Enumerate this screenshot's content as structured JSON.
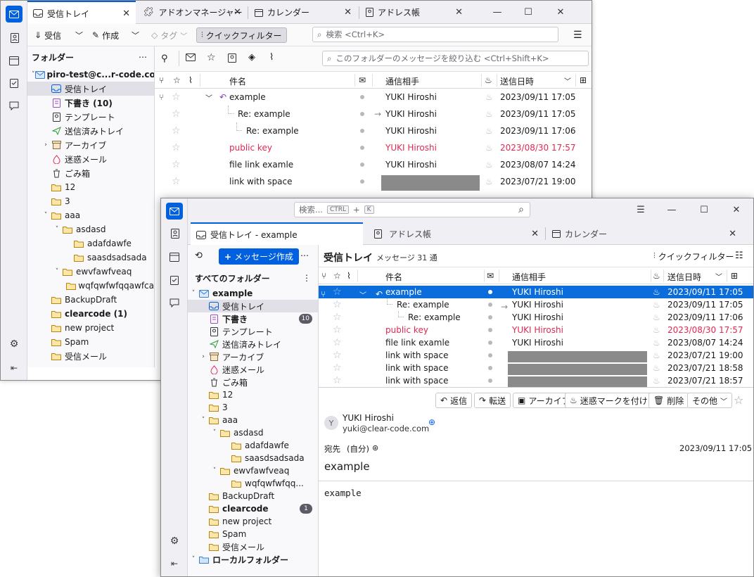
{
  "win1": {
    "tabs": [
      {
        "label": "受信トレイ"
      },
      {
        "label": "アドオンマネージャー"
      },
      {
        "label": "カレンダー"
      },
      {
        "label": "アドレス帳"
      }
    ],
    "toolbar": {
      "get_messages": "受信",
      "compose": "作成",
      "tag": "タグ",
      "quick_filter": "クイックフィルター",
      "search_placeholder": "検索 <Ctrl+K>"
    },
    "folder_pane": {
      "header": "フォルダー",
      "account": "piro-test@c...r-code.com",
      "items": [
        {
          "label": "受信トレイ"
        },
        {
          "label": "下書き (10)"
        },
        {
          "label": "テンプレート"
        },
        {
          "label": "送信済みトレイ"
        },
        {
          "label": "アーカイブ"
        },
        {
          "label": "迷惑メール"
        },
        {
          "label": "ごみ箱"
        },
        {
          "label": "12"
        },
        {
          "label": "3"
        },
        {
          "label": "aaa"
        },
        {
          "label": "asdasd"
        },
        {
          "label": "adafdawfe"
        },
        {
          "label": "saasdsadsada"
        },
        {
          "label": "ewvfawfveaq"
        },
        {
          "label": "wqfqwfwfqqawfca"
        },
        {
          "label": "BackupDraft"
        },
        {
          "label": "clearcode (1)"
        },
        {
          "label": "new project"
        },
        {
          "label": "Spam"
        },
        {
          "label": "受信メール"
        }
      ]
    },
    "filter_placeholder": "このフォルダーのメッセージを絞り込む <Ctrl+Shift+K>",
    "columns": {
      "subject": "件名",
      "correspondent": "通信相手",
      "date": "送信日時"
    },
    "messages": [
      {
        "subject": "example",
        "from": "YUKI Hiroshi",
        "date": "2023/09/11 17:05"
      },
      {
        "subject": "Re: example",
        "from": "YUKI Hiroshi",
        "date": "2023/09/11 17:05"
      },
      {
        "subject": "Re: example",
        "from": "YUKI Hiroshi",
        "date": "2023/09/11 17:06"
      },
      {
        "subject": "public key",
        "from": "YUKI Hiroshi",
        "date": "2023/08/30 17:57"
      },
      {
        "subject": "file link examle",
        "from": "YUKI Hiroshi",
        "date": "2023/08/07 14:24"
      },
      {
        "subject": "link with space",
        "from": "",
        "date": "2023/07/21 19:00"
      }
    ]
  },
  "win2": {
    "search_placeholder": "検索...",
    "search_key1": "CTRL",
    "search_plus": "+",
    "search_key2": "K",
    "tabs": [
      {
        "label": "受信トレイ - example"
      },
      {
        "label": "アドレス帳"
      },
      {
        "label": "カレンダー"
      }
    ],
    "new_message": "メッセージ作成",
    "folder_header": "すべてのフォルダー",
    "folder_title": "受信トレイ",
    "message_count": "メッセージ 31 通",
    "quick_filter": "クイックフィルター",
    "account": "example",
    "folders": [
      {
        "label": "受信トレイ"
      },
      {
        "label": "下書き",
        "badge": "10"
      },
      {
        "label": "テンプレート"
      },
      {
        "label": "送信済みトレイ"
      },
      {
        "label": "アーカイブ"
      },
      {
        "label": "迷惑メール"
      },
      {
        "label": "ごみ箱"
      },
      {
        "label": "12"
      },
      {
        "label": "3"
      },
      {
        "label": "aaa"
      },
      {
        "label": "asdasd"
      },
      {
        "label": "adafdawfe"
      },
      {
        "label": "saasdsadsada"
      },
      {
        "label": "ewvfawfveaq"
      },
      {
        "label": "wqfqwfwfqq..."
      },
      {
        "label": "BackupDraft"
      },
      {
        "label": "clearcode",
        "badge": "1"
      },
      {
        "label": "new project"
      },
      {
        "label": "Spam"
      },
      {
        "label": "受信メール"
      },
      {
        "label": "ローカルフォルダー"
      }
    ],
    "columns": {
      "subject": "件名",
      "correspondent": "通信相手",
      "date": "送信日時"
    },
    "messages": [
      {
        "subject": "example",
        "from": "YUKI Hiroshi",
        "date": "2023/09/11 17:05"
      },
      {
        "subject": "Re: example",
        "from": "YUKI Hiroshi",
        "date": "2023/09/11 17:05"
      },
      {
        "subject": "Re: example",
        "from": "YUKI Hiroshi",
        "date": "2023/09/11 17:06"
      },
      {
        "subject": "public key",
        "from": "YUKI Hiroshi",
        "date": "2023/08/30 17:57"
      },
      {
        "subject": "file link examle",
        "from": "YUKI Hiroshi",
        "date": "2023/08/07 14:24"
      },
      {
        "subject": "link with space",
        "from": "",
        "date": "2023/07/21 19:00"
      },
      {
        "subject": "link with space",
        "from": "",
        "date": "2023/07/21 18:58"
      },
      {
        "subject": "link with space",
        "from": "",
        "date": "2023/07/21 18:57"
      }
    ],
    "reader": {
      "buttons": {
        "reply": "返信",
        "forward": "転送",
        "archive": "アーカイブ",
        "junk": "迷惑マークを付ける",
        "delete": "削除",
        "more": "その他"
      },
      "avatar_letter": "Y",
      "from_name": "YUKI Hiroshi",
      "from_email": "yuki@clear-code.com",
      "to_label": "宛先",
      "to_value": "(自分)",
      "date": "2023/09/11 17:05",
      "subject": "example",
      "body": "example"
    }
  },
  "colors": {
    "accent": "#0060df",
    "selected_row": "#0a6ddb",
    "unread_red": "#e22850"
  }
}
